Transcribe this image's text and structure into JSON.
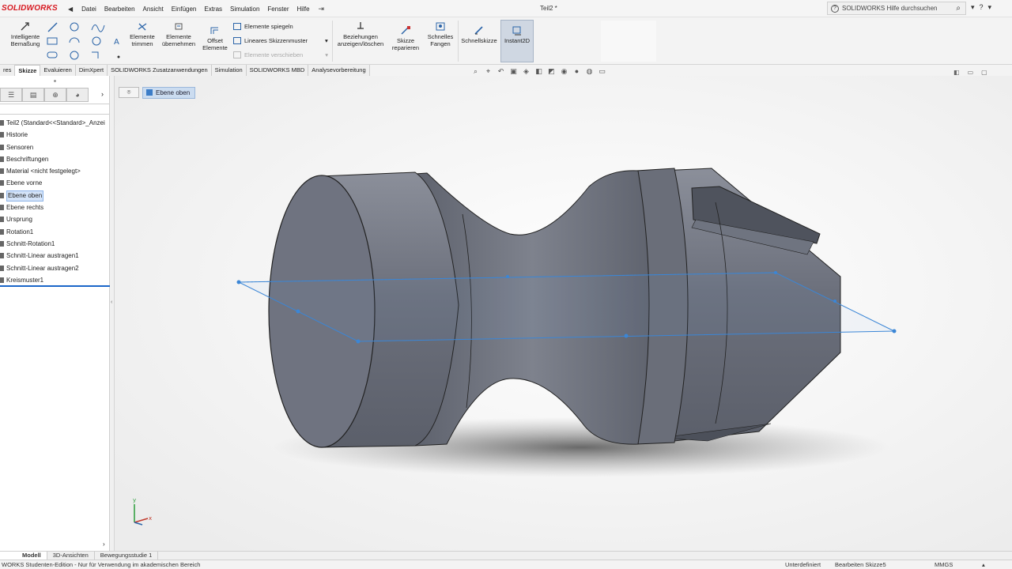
{
  "app": {
    "logo": "SOLIDWORKS",
    "document_title": "Teil2 *"
  },
  "menu": [
    "Datei",
    "Bearbeiten",
    "Ansicht",
    "Einfügen",
    "Extras",
    "Simulation",
    "Fenster",
    "Hilfe"
  ],
  "search": {
    "placeholder": "SOLIDWORKS Hilfe durchsuchen"
  },
  "ribbon": {
    "smart_dimension": "Intelligente Bemaßung",
    "trim": "Elemente trimmen",
    "convert": "Elemente übernehmen",
    "offset": "Offset Elemente",
    "mirror": "Elemente spiegeln",
    "linear_pattern": "Lineares Skizzenmuster",
    "move": "Elemente verschieben",
    "relations": "Beziehungen anzeigen/löschen",
    "repair": "Skizze reparieren",
    "quick_snaps": "Schnelles Fangen",
    "rapid_sketch": "Schnellskizze",
    "instant2d": "Instant2D"
  },
  "tabs": [
    "res",
    "Skizze",
    "Evaluieren",
    "DimXpert",
    "SOLIDWORKS Zusatzanwendungen",
    "Simulation",
    "SOLIDWORKS MBD",
    "Analysevorbereitung"
  ],
  "active_tab": "Skizze",
  "tree": [
    "Teil2  (Standard<<Standard>_Anzei",
    "Historie",
    "Sensoren",
    "Beschriftungen",
    "Material <nicht festgelegt>",
    "Ebene vorne",
    "Ebene oben",
    "Ebene rechts",
    "Ursprung",
    "Rotation1",
    "Schnitt-Rotation1",
    "Schnitt-Linear austragen1",
    "Schnitt-Linear austragen2",
    "Kreismuster1"
  ],
  "selected_tree_item": "Ebene oben",
  "breadcrumb": {
    "plane": "Ebene oben"
  },
  "bottom_tabs": [
    "Modell",
    "3D-Ansichten",
    "Bewegungsstudie 1"
  ],
  "status": {
    "edition": "WORKS Studenten-Edition - Nur für Verwendung im akademischen Bereich",
    "definition": "Unterdefiniert",
    "editing": "Bearbeiten Skizze5",
    "units": "MMGS"
  },
  "colors": {
    "brand": "#d71920",
    "selection": "#1b66c9",
    "model": "#6e7380"
  }
}
